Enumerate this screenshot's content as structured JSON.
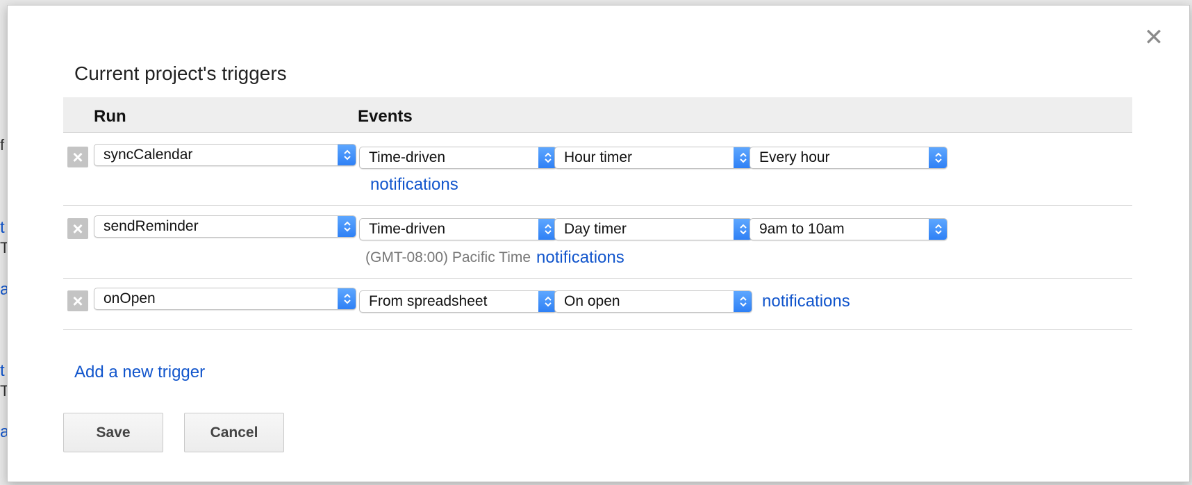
{
  "background_fragments": [
    {
      "text": "f",
      "style": "dark"
    },
    {
      "text": "t",
      "style": "link"
    },
    {
      "text": "T",
      "style": "dark"
    },
    {
      "text": "a",
      "style": "link"
    },
    {
      "text": "t",
      "style": "link"
    },
    {
      "text": "T",
      "style": "dark"
    },
    {
      "text": "a",
      "style": "link"
    }
  ],
  "dialog": {
    "title": "Current project's triggers",
    "close_icon": "close-icon",
    "columns": {
      "run": "Run",
      "events": "Events"
    },
    "triggers": [
      {
        "function": "syncCalendar",
        "event_source": "Time-driven",
        "event_type": "Hour timer",
        "event_detail": "Every hour",
        "timezone": "",
        "notifications_label": "notifications"
      },
      {
        "function": "sendReminder",
        "event_source": "Time-driven",
        "event_type": "Day timer",
        "event_detail": "9am to 10am",
        "timezone": "(GMT-08:00) Pacific Time",
        "notifications_label": "notifications"
      },
      {
        "function": "onOpen",
        "event_source": "From spreadsheet",
        "event_type": "On open",
        "event_detail": "",
        "timezone": "",
        "notifications_label": "notifications"
      }
    ],
    "add_trigger_label": "Add a new trigger",
    "save_label": "Save",
    "cancel_label": "Cancel"
  },
  "colors": {
    "link": "#1155cc",
    "select_arrow": "#2d7ff5",
    "header_bg": "#eeeeee",
    "delete_button": "#c4c4c4"
  }
}
